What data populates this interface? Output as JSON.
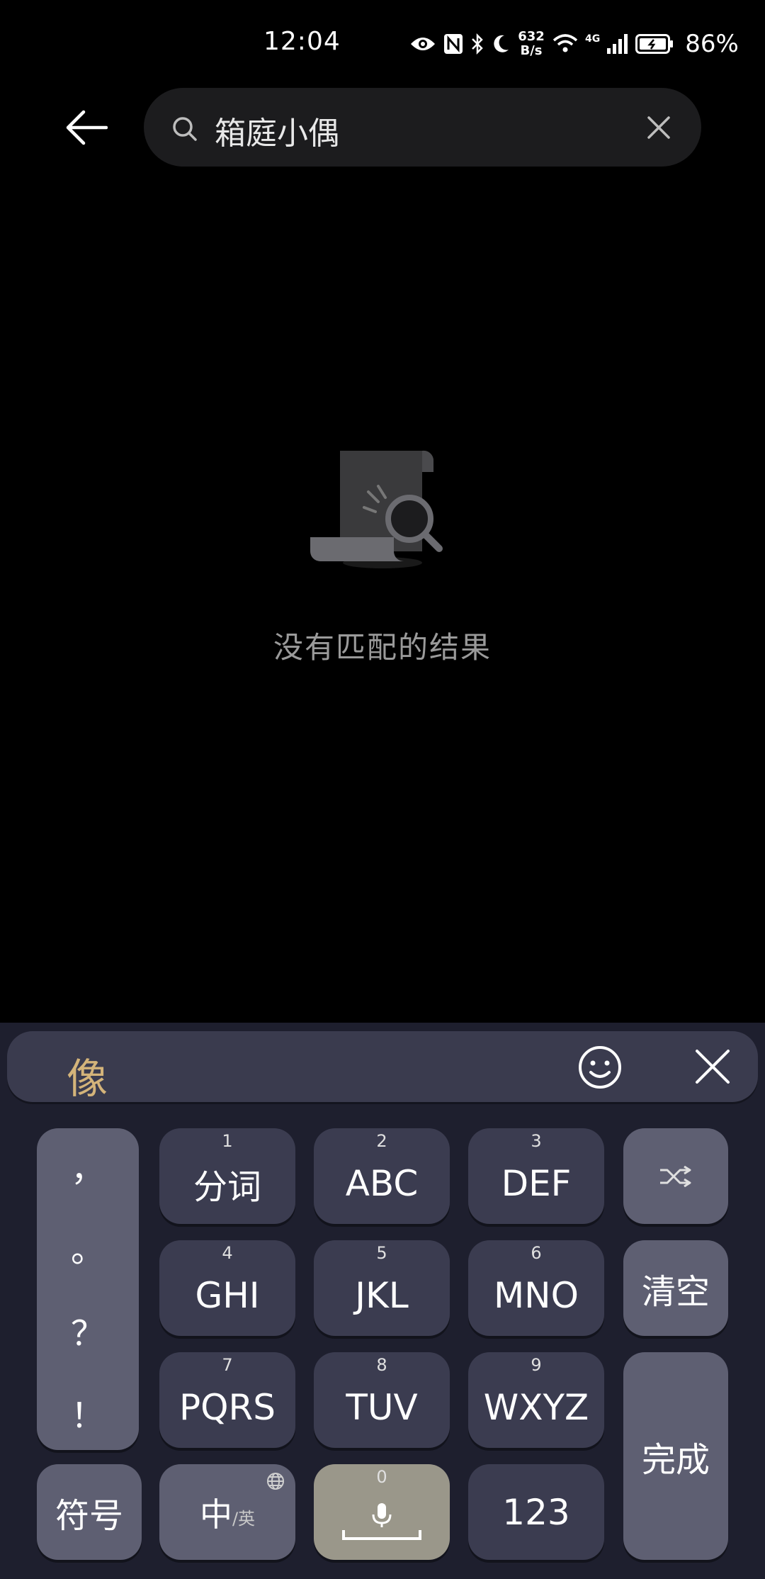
{
  "status_bar": {
    "time": "12:04",
    "net_speed_value": "632",
    "net_speed_unit": "B/s",
    "network_type": "4G",
    "battery": "86%"
  },
  "search": {
    "query": "箱庭小偶",
    "icons": [
      "back-arrow-icon",
      "search-icon",
      "close-icon"
    ]
  },
  "empty_state": {
    "message": "没有匹配的结果",
    "icon": "document-search-icon"
  },
  "keyboard": {
    "candidate": "像",
    "punctuation": [
      "，",
      "。",
      "？",
      "！"
    ],
    "keys": [
      {
        "num": "1",
        "label": "分词"
      },
      {
        "num": "2",
        "label": "ABC"
      },
      {
        "num": "3",
        "label": "DEF"
      },
      {
        "num": "4",
        "label": "GHI"
      },
      {
        "num": "5",
        "label": "JKL"
      },
      {
        "num": "6",
        "label": "MNO"
      },
      {
        "num": "7",
        "label": "PQRS"
      },
      {
        "num": "8",
        "label": "TUV"
      },
      {
        "num": "9",
        "label": "WXYZ"
      }
    ],
    "clear_label": "清空",
    "done_label": "完成",
    "symbol_label": "符号",
    "lang_main": "中",
    "lang_sub": "/英",
    "space_num": "0",
    "num_label": "123"
  },
  "colors": {
    "candidate": "#d4b47a",
    "keyboard_bg": "#1e1f2e",
    "key_bg": "#3b3c50",
    "fn_key_bg": "#5e5f72",
    "space_key_bg": "#9a978a"
  }
}
